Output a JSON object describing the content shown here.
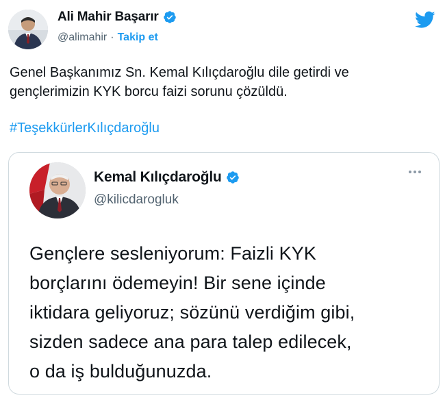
{
  "author": {
    "name": "Ali Mahir Başarır",
    "handle": "@alimahir",
    "separator": "·",
    "follow_label": "Takip et",
    "verified": true,
    "avatar_icon": "person-avatar-icon"
  },
  "tweet": {
    "text": "Genel Başkanımız Sn. Kemal Kılıçdaroğlu dile getirdi ve\ngençlerimizin KYK borcu faizi sorunu çözüldü.",
    "hashtag": "#TeşekkürlerKılıçdaroğlu"
  },
  "quoted": {
    "name": "Kemal Kılıçdaroğlu",
    "handle": "@kilicdarogluk",
    "verified": true,
    "text": "Gençlere sesleniyorum: Faizli KYK\nborçlarını ödemeyin! Bir sene içinde\niktidara geliyoruz; sözünü verdiğim gibi,\nsizden sadece ana para talep edilecek,\no da iş bulduğunuzda.",
    "avatar_icon": "person-avatar-icon"
  },
  "colors": {
    "accent": "#1d9bf0",
    "text_primary": "#0f1419",
    "text_secondary": "#536471",
    "border": "#cfd9de"
  },
  "icons": {
    "brand": "twitter-bird-icon",
    "verified": "verified-badge-icon",
    "more": "more-options-icon"
  }
}
